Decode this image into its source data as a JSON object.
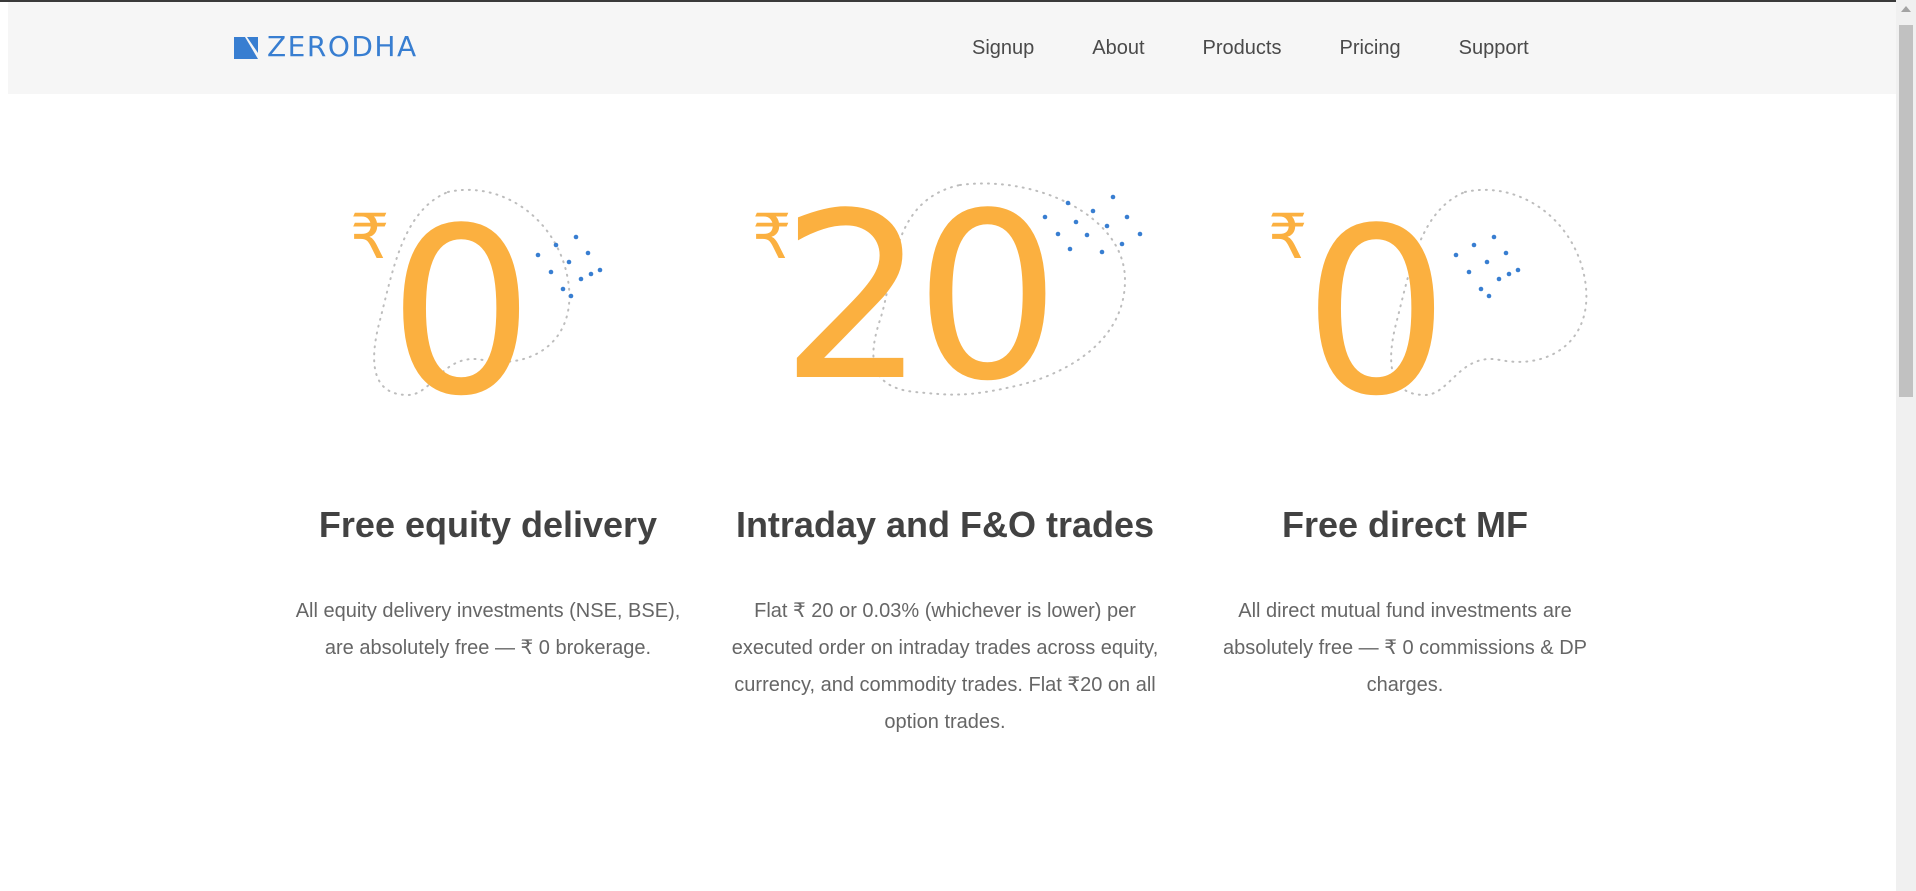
{
  "brand": {
    "name": "ZERODHA",
    "color": "#387ed1"
  },
  "nav": {
    "links": [
      "Signup",
      "About",
      "Products",
      "Pricing",
      "Support"
    ]
  },
  "colors": {
    "accent_orange": "#fbb040",
    "dot_blue": "#387ed1",
    "heading": "#424242",
    "body_text": "#666666"
  },
  "features": [
    {
      "currency": "₹",
      "amount": "0",
      "title": "Free equity delivery",
      "description": "All equity delivery investments (NSE, BSE), are absolutely free — ₹ 0 brokerage."
    },
    {
      "currency": "₹",
      "amount": "20",
      "title": "Intraday and F&O trades",
      "description": "Flat ₹ 20 or 0.03% (whichever is lower) per executed order on intraday trades across equity, currency, and commodity trades. Flat ₹20 on all option trades."
    },
    {
      "currency": "₹",
      "amount": "0",
      "title": "Free direct MF",
      "description": "All direct mutual fund investments are absolutely free — ₹ 0 commissions & DP charges."
    }
  ]
}
